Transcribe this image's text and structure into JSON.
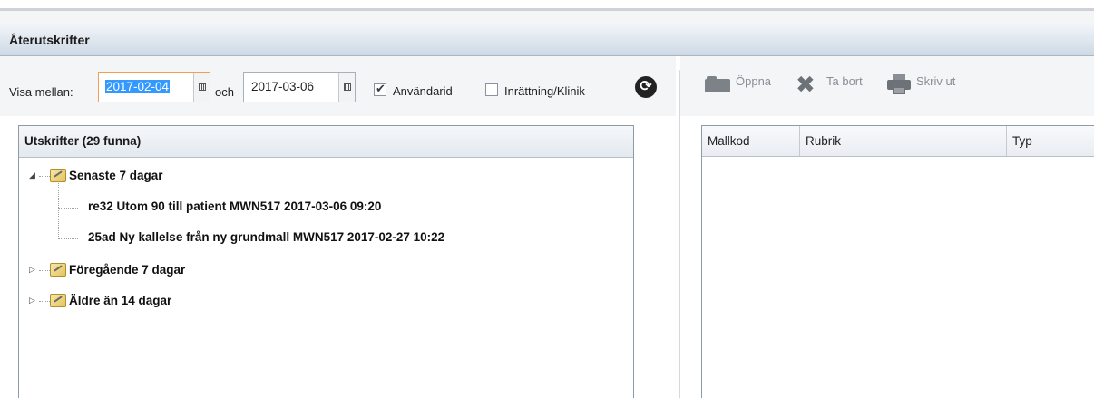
{
  "title": "Återutskrifter",
  "filter": {
    "visa_label": "Visa mellan:",
    "from_date": "2017-02-04",
    "och_label": "och",
    "to_date": "2017-03-06",
    "anvandarid_label": "Användarid",
    "anvandarid_checked": true,
    "inrattning_label": "Inrättning/Klinik",
    "inrattning_checked": false
  },
  "toolbar": {
    "open_label": "Öppna",
    "delete_label": "Ta bort",
    "print_label": "Skriv ut"
  },
  "left_panel": {
    "header": "Utskrifter (29 funna)",
    "groups": [
      {
        "label": "Senaste 7 dagar",
        "expanded": true,
        "items": [
          "re32  Utom 90 till patient  MWN517  2017-03-06 09:20",
          "25ad  Ny kallelse från ny grundmall  MWN517  2017-02-27 10:22"
        ]
      },
      {
        "label": "Föregående 7 dagar",
        "expanded": false
      },
      {
        "label": "Äldre än 14 dagar",
        "expanded": false
      }
    ]
  },
  "right_panel": {
    "columns": [
      "Mallkod",
      "Rubrik",
      "Typ"
    ]
  }
}
